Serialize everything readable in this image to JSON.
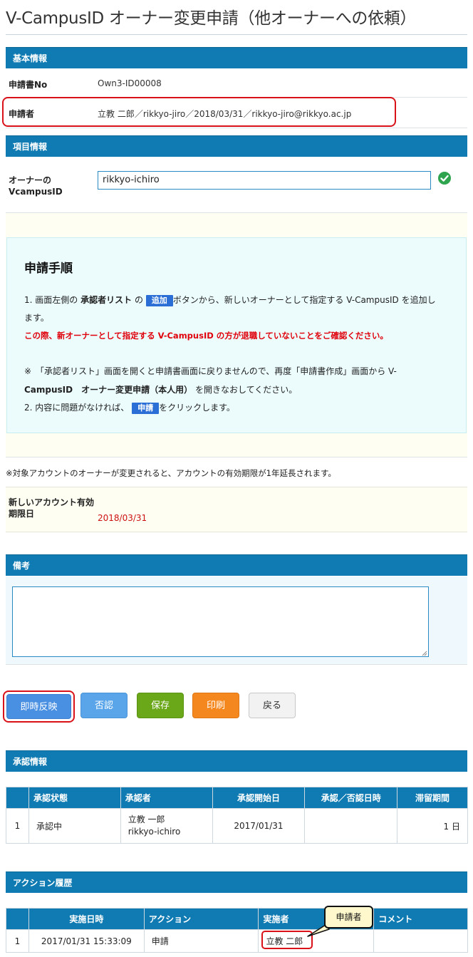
{
  "page": {
    "title": "V-CampusID オーナー変更申請（他オーナーへの依頼）"
  },
  "basic_info": {
    "header": "基本情報",
    "rows": [
      {
        "label": "申請書No",
        "value": "Own3-ID00008"
      },
      {
        "label": "申請者",
        "value": "立教 二郎／rikkyo-jiro／2018/03/31／rikkyo-jiro@rikkyo.ac.jp"
      }
    ]
  },
  "item_info": {
    "header": "項目情報",
    "owner_label_line1": "オーナーの",
    "owner_label_line2": "VcampusID",
    "owner_value": "rikkyo-ichiro",
    "valid_icon": "check-circle-icon"
  },
  "procedure": {
    "title": "申請手順",
    "step1_pre": "1. 画面左側の",
    "step1_bold": "承認者リスト",
    "step1_mid": "の",
    "step1_tag": "追加",
    "step1_post": "ボタンから、新しいオーナーとして指定する V-CampusID を追加し",
    "step1_cont": "ます。",
    "warning": "この際、新オーナーとして指定する V-CampusID の方が退職していないことをご確認ください。",
    "note_line1": "※　「承認者リスト」画面を開くと申請書画面に戻りませんので、再度「申請書作成」画面から V-",
    "note_line2_bold": "CampusID　オーナー変更申請（本人用）",
    "note_line2_post": "を開きなおしてください。",
    "step2_pre": "2. 内容に問題がなければ、",
    "step2_tag": "申請",
    "step2_post": "をクリックします。"
  },
  "extension_note": "※対象アカウントのオーナーが変更されると、アカウントの有効期限が1年延長されます。",
  "expiry": {
    "label_line1": "新しいアカウント有効",
    "label_line2": "期限日",
    "value": "2018/03/31"
  },
  "remarks": {
    "header": "備考",
    "value": ""
  },
  "buttons": {
    "immediate": "即時反映",
    "reject": "否認",
    "save": "保存",
    "print": "印刷",
    "back": "戻る"
  },
  "approval": {
    "header": "承認情報",
    "columns": [
      "",
      "承認状態",
      "承認者",
      "承認開始日",
      "承認／否認日時",
      "滞留期間"
    ],
    "rows": [
      {
        "no": "1",
        "status": "承認中",
        "approver_name": "立教 一郎",
        "approver_id": "rikkyo-ichiro",
        "start": "2017/01/31",
        "decided": "",
        "days": "1 日"
      }
    ]
  },
  "history": {
    "header": "アクション履歴",
    "columns": [
      "",
      "実施日時",
      "アクション",
      "実施者",
      "コメント"
    ],
    "rows": [
      {
        "no": "1",
        "datetime": "2017/01/31 15:33:09",
        "action": "申請",
        "actor": "立教 二郎",
        "comment": ""
      }
    ],
    "callout": "申請者"
  },
  "colors": {
    "header_bar": "#0f7bb2",
    "highlight": "#d9121a",
    "warning_text": "#e0000b",
    "date_text": "#cc1111",
    "btn_immediate": "#4a90e2",
    "btn_reject": "#5aa5ea",
    "btn_save": "#6aa81a",
    "btn_print": "#f5871f",
    "btn_back": "#f2f2f2"
  }
}
